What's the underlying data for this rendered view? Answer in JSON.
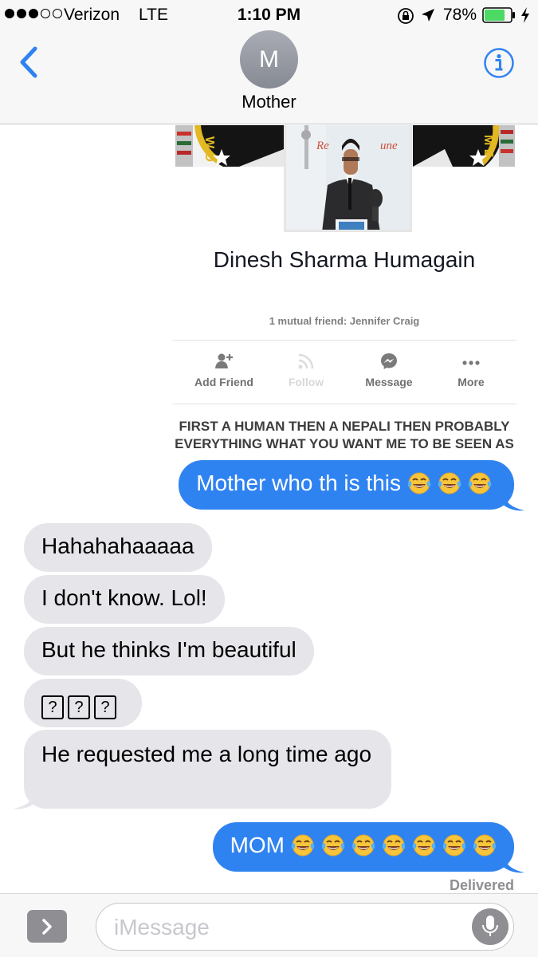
{
  "status_bar": {
    "carrier": "Verizon",
    "network": "LTE",
    "time": "1:10 PM",
    "battery_percent": "78%",
    "battery_level": 0.78,
    "signal_bars_filled": 3,
    "signal_bars_total": 5
  },
  "header": {
    "avatar_initial": "M",
    "contact_name": "Mother",
    "back_icon": "chevron-left-icon",
    "info_icon": "info-icon"
  },
  "shared_image": {
    "profile_name": "Dinesh Sharma Humagain",
    "mutual_friends": "1 mutual friend: Jennifer Craig",
    "actions": [
      {
        "label": "Add Friend",
        "icon": "add-friend-icon"
      },
      {
        "label": "Follow",
        "icon": "follow-icon"
      },
      {
        "label": "Message",
        "icon": "messenger-icon"
      },
      {
        "label": "More",
        "icon": "more-icon"
      }
    ],
    "bio": "FIRST A HUMAN THEN A NEPALI THEN PROBABLY EVERYTHING WHAT YOU WANT ME TO BE SEEN AS"
  },
  "messages": [
    {
      "from": "me",
      "text": "Mother who th is this",
      "emoji_count": 3
    },
    {
      "from": "contact",
      "text": "Hahahahaaaaa"
    },
    {
      "from": "contact",
      "text": "I don't know. Lol!"
    },
    {
      "from": "contact",
      "text": "But he thinks I'm beautiful"
    },
    {
      "from": "contact",
      "text": "???"
    },
    {
      "from": "contact",
      "text": "He requested me a long time ago"
    },
    {
      "from": "me",
      "text": "MOM",
      "emoji_count": 7
    }
  ],
  "delivery_status": "Delivered",
  "input": {
    "placeholder": "iMessage"
  },
  "colors": {
    "sent_bubble": "#2f83f1",
    "received_bubble": "#e5e5ea",
    "ios_blue": "#2f83f1",
    "battery_green": "#4cd964"
  }
}
